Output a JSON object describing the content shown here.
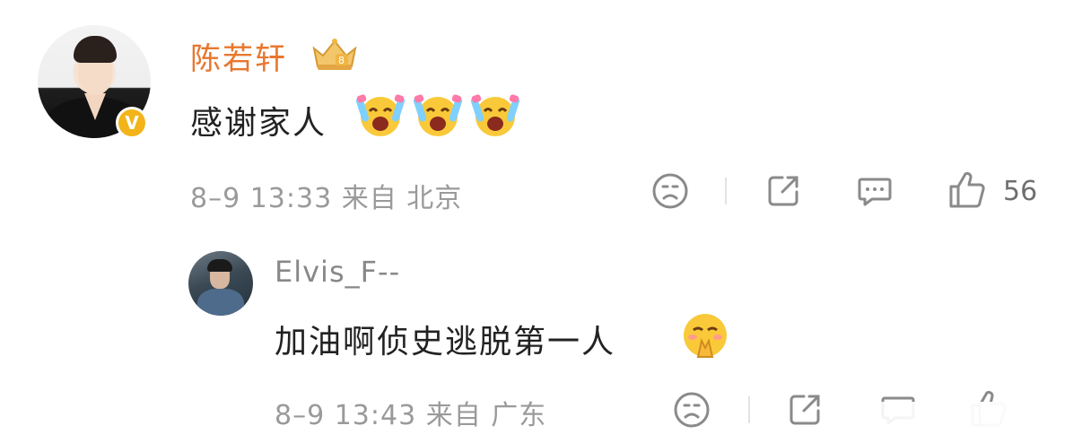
{
  "main_comment": {
    "username": "陈若轩",
    "verified_badge": "V",
    "crown_icon": "vip-crown-icon",
    "text": "感谢家人",
    "emojis": [
      "laugh-cry-emoji",
      "laugh-cry-emoji",
      "laugh-cry-emoji"
    ],
    "meta": "8–9 13:33 来自 北京",
    "actions": {
      "dislike_icon": "sad-face-icon",
      "share_icon": "share-icon",
      "comment_icon": "comment-icon",
      "like_icon": "thumbs-up-icon",
      "like_count": "56"
    }
  },
  "reply": {
    "username": "Elvis_F--",
    "text": "加油啊侦史逃脱第一人",
    "emoji": "pleading-emoji",
    "meta": "8–9 13:43 来自 广东"
  },
  "colors": {
    "username_orange": "#e8772e",
    "meta_gray": "#9a9a9a",
    "text_dark": "#222222",
    "verified_gold": "#f2b418"
  }
}
